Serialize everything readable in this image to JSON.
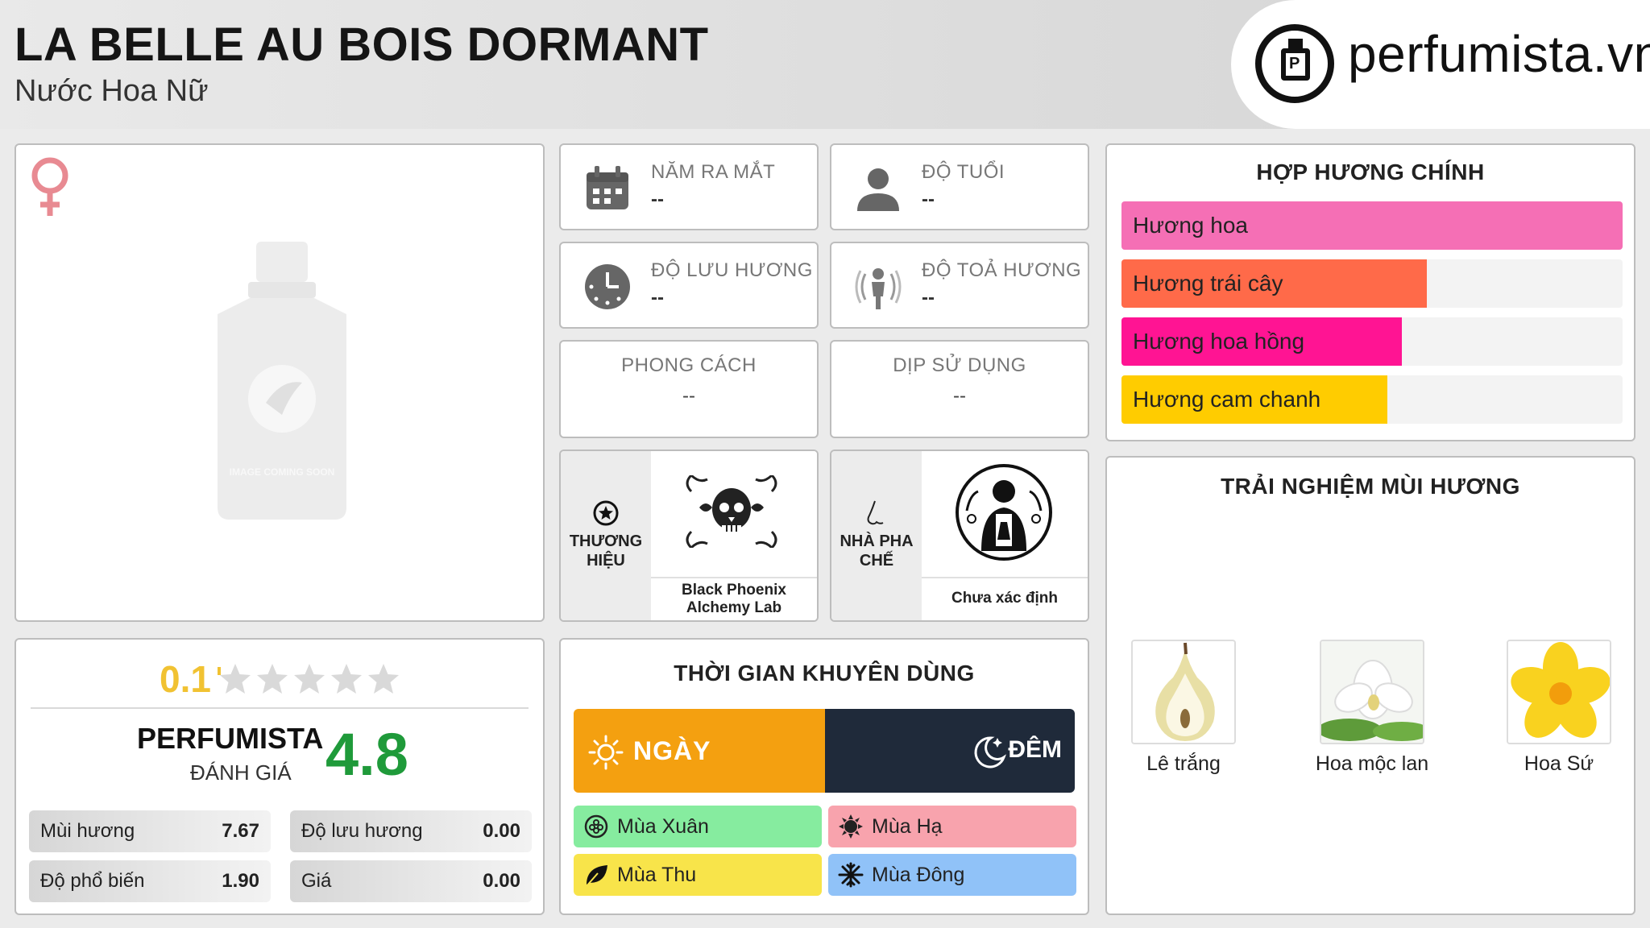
{
  "header": {
    "title": "LA BELLE AU BOIS DORMANT",
    "subtitle": "Nước Hoa Nữ",
    "logo_text": "perfumista.vn"
  },
  "image_panel": {
    "placeholder_text": "IMAGE COMING SOON",
    "gender_icon": "female-symbol-icon",
    "accent_color": "#e88a92"
  },
  "info": {
    "release_year": {
      "label": "NĂM RA MẮT",
      "value": "--",
      "icon": "calendar-icon"
    },
    "age": {
      "label": "ĐỘ TUỔI",
      "value": "--",
      "icon": "person-icon"
    },
    "longevity": {
      "label": "ĐỘ LƯU HƯƠNG",
      "value": "--",
      "icon": "clock-icon"
    },
    "sillage": {
      "label": "ĐỘ TOẢ HƯƠNG",
      "value": "--",
      "icon": "aura-person-icon"
    },
    "style": {
      "label": "PHONG CÁCH",
      "value": "--"
    },
    "occasion": {
      "label": "DỊP SỬ DỤNG",
      "value": "--"
    },
    "brand": {
      "label": "THƯƠNG HIỆU",
      "name": "Black Phoenix Alchemy Lab",
      "icon": "star-circle-icon"
    },
    "perfumer": {
      "label": "NHÀ PHA CHẾ",
      "name": "Chưa xác định",
      "icon": "nose-icon"
    }
  },
  "accords": {
    "title": "HỢP HƯƠNG CHÍNH",
    "items": [
      {
        "label": "Hương hoa",
        "percent": 100,
        "color": "#f56fb5"
      },
      {
        "label": "Hương trái cây",
        "percent": 61,
        "color": "#ff6a49"
      },
      {
        "label": "Hương hoa hồng",
        "percent": 56,
        "color": "#ff1493"
      },
      {
        "label": "Hương cam chanh",
        "percent": 53,
        "color": "#ffcc00"
      }
    ]
  },
  "notes": {
    "title": "TRẢI NGHIỆM MÙI HƯƠNG",
    "items": [
      {
        "label": "Lê trắng"
      },
      {
        "label": "Hoa mộc lan"
      },
      {
        "label": "Hoa Sứ"
      }
    ]
  },
  "rating": {
    "user_score": "0.1",
    "user_stars": 0.02,
    "perfumista_label": "PERFUMISTA",
    "perfumista_sub": "ĐÁNH GIÁ",
    "perfumista_score": "4.8",
    "metrics": [
      {
        "label": "Mùi hương",
        "value": "7.67"
      },
      {
        "label": "Độ lưu hương",
        "value": "0.00"
      },
      {
        "label": "Độ phổ biến",
        "value": "1.90"
      },
      {
        "label": "Giá",
        "value": "0.00"
      }
    ]
  },
  "time": {
    "title": "THỜI GIAN KHUYÊN DÙNG",
    "day": "NGÀY",
    "night": "ĐÊM",
    "day_color": "#f4a010",
    "night_color": "#1f2a3a",
    "seasons": [
      {
        "label": "Mùa Xuân",
        "color": "#86ec9f",
        "icon": "flower-badge-icon"
      },
      {
        "label": "Mùa Hạ",
        "color": "#f8a3ad",
        "icon": "sun-icon"
      },
      {
        "label": "Mùa Thu",
        "color": "#f8e44a",
        "icon": "leaf-icon"
      },
      {
        "label": "Mùa Đông",
        "color": "#90c2f8",
        "icon": "snowflake-icon"
      }
    ]
  }
}
